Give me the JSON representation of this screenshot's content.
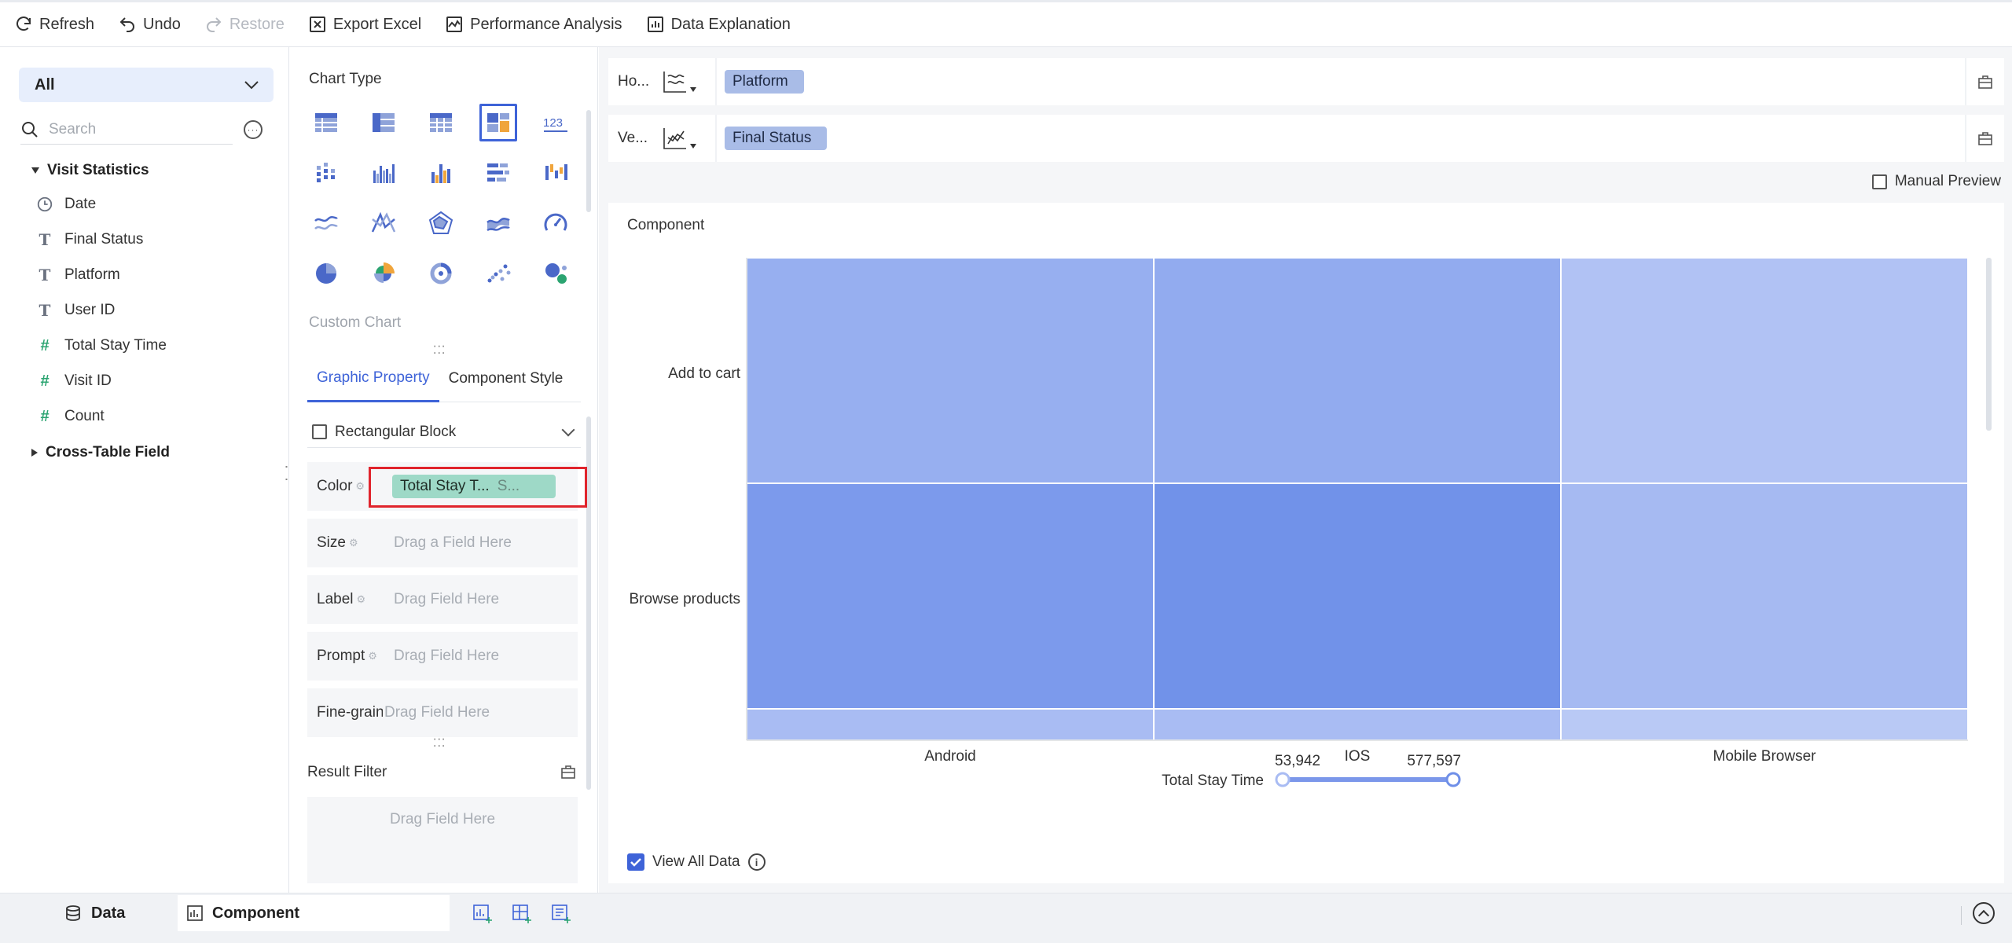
{
  "toolbar": {
    "refresh": "Refresh",
    "undo": "Undo",
    "restore": "Restore",
    "export_excel": "Export Excel",
    "performance_analysis": "Performance Analysis",
    "data_explanation": "Data Explanation"
  },
  "fields_pane": {
    "dataset_select": "All",
    "search_placeholder": "Search",
    "group_visit_statistics": "Visit Statistics",
    "fields": [
      {
        "label": "Date",
        "type": "date"
      },
      {
        "label": "Final Status",
        "type": "text"
      },
      {
        "label": "Platform",
        "type": "text"
      },
      {
        "label": "User ID",
        "type": "text"
      },
      {
        "label": "Total Stay Time",
        "type": "number"
      },
      {
        "label": "Visit ID",
        "type": "number"
      },
      {
        "label": "Count",
        "type": "number"
      }
    ],
    "group_cross_table": "Cross-Table Field"
  },
  "config_pane": {
    "chart_type_title": "Chart Type",
    "custom_chart": "Custom Chart",
    "tab_graphic_property": "Graphic Property",
    "tab_component_style": "Component Style",
    "rectangular_block": "Rectangular Block",
    "color_label": "Color",
    "color_field": "Total Stay T...",
    "color_field_sub": "S...",
    "size_label": "Size",
    "size_placeholder": "Drag a Field Here",
    "label_label": "Label",
    "label_placeholder": "Drag Field Here",
    "prompt_label": "Prompt",
    "prompt_placeholder": "Drag Field Here",
    "fine_grained_label": "Fine-grained",
    "fine_grained_placeholder": "Drag Field Here",
    "result_filter_title": "Result Filter",
    "result_filter_placeholder": "Drag Field Here"
  },
  "axes": {
    "horizontal_label": "Ho...",
    "horizontal_field": "Platform",
    "vertical_label": "Ve...",
    "vertical_field": "Final Status",
    "manual_preview": "Manual Preview"
  },
  "component": {
    "title": "Component",
    "view_all_data": "View All Data",
    "legend_title": "Total Stay Time",
    "legend_min": "53,942",
    "legend_max": "577,597"
  },
  "chart_data": {
    "type": "heatmap",
    "x_categories": [
      "Android",
      "IOS",
      "Mobile Browser"
    ],
    "y_categories": [
      "Add to cart",
      "Browse products",
      ""
    ],
    "cells": [
      {
        "x": "Android",
        "y": "Add to cart",
        "color": "#97aff0"
      },
      {
        "x": "IOS",
        "y": "Add to cart",
        "color": "#92abef"
      },
      {
        "x": "Mobile Browser",
        "y": "Add to cart",
        "color": "#b1c2f4"
      },
      {
        "x": "Android",
        "y": "Browse products",
        "color": "#7c9aec"
      },
      {
        "x": "IOS",
        "y": "Browse products",
        "color": "#7192e9"
      },
      {
        "x": "Mobile Browser",
        "y": "Browse products",
        "color": "#a6baf2"
      },
      {
        "x": "Android",
        "y": "",
        "color": "#a9bcf3"
      },
      {
        "x": "IOS",
        "y": "",
        "color": "#a9bcf3"
      },
      {
        "x": "Mobile Browser",
        "y": "",
        "color": "#b9c9f5"
      }
    ],
    "color_legend": {
      "field": "Total Stay Time",
      "min": 53942,
      "max": 577597
    }
  },
  "bottom_bar": {
    "data_tab": "Data",
    "component_tab": "Component"
  },
  "colors": {
    "accent": "#3e63d8",
    "highlight": "#e0242c",
    "color_pill": "#9ed9c7",
    "axis_pill": "#a9bce7"
  }
}
